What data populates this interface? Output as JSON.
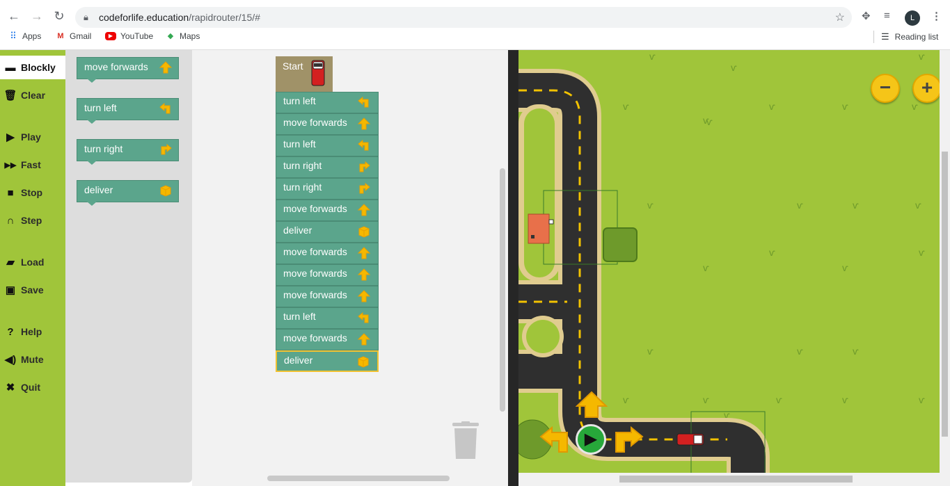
{
  "browser": {
    "url_host": "codeforlife.education",
    "url_path": "/rapidrouter/15/#",
    "avatar_letter": "L",
    "bookmarks": [
      {
        "label": "Apps",
        "icon": "apps-grid-icon"
      },
      {
        "label": "Gmail",
        "icon": "gmail-icon"
      },
      {
        "label": "YouTube",
        "icon": "youtube-icon"
      },
      {
        "label": "Maps",
        "icon": "maps-icon"
      }
    ],
    "reading_list": "Reading list"
  },
  "menu": {
    "items": [
      {
        "label": "Blockly",
        "icon": "blockly-icon"
      },
      {
        "label": "Clear",
        "icon": "trash-icon"
      },
      {
        "label": "Play",
        "icon": "play-icon"
      },
      {
        "label": "Fast",
        "icon": "fast-forward-icon"
      },
      {
        "label": "Stop",
        "icon": "stop-icon"
      },
      {
        "label": "Step",
        "icon": "step-icon"
      },
      {
        "label": "Load",
        "icon": "folder-icon"
      },
      {
        "label": "Save",
        "icon": "save-icon"
      },
      {
        "label": "Help",
        "icon": "help-icon"
      },
      {
        "label": "Mute",
        "icon": "speaker-icon"
      },
      {
        "label": "Quit",
        "icon": "close-icon"
      }
    ]
  },
  "toolbox": {
    "blocks": [
      {
        "label": "move forwards",
        "icon": "arrow-up-icon"
      },
      {
        "label": "turn left",
        "icon": "arrow-left-icon"
      },
      {
        "label": "turn right",
        "icon": "arrow-right-icon"
      },
      {
        "label": "deliver",
        "icon": "box-icon"
      }
    ]
  },
  "workspace": {
    "start_label": "Start",
    "program": [
      {
        "label": "turn left",
        "icon": "arrow-left-icon"
      },
      {
        "label": "move forwards",
        "icon": "arrow-up-icon"
      },
      {
        "label": "turn left",
        "icon": "arrow-left-icon"
      },
      {
        "label": "turn right",
        "icon": "arrow-right-icon"
      },
      {
        "label": "turn right",
        "icon": "arrow-right-icon"
      },
      {
        "label": "move forwards",
        "icon": "arrow-up-icon"
      },
      {
        "label": "deliver",
        "icon": "box-icon"
      },
      {
        "label": "move forwards",
        "icon": "arrow-up-icon"
      },
      {
        "label": "move forwards",
        "icon": "arrow-up-icon"
      },
      {
        "label": "move forwards",
        "icon": "arrow-up-icon"
      },
      {
        "label": "turn left",
        "icon": "arrow-left-icon"
      },
      {
        "label": "move forwards",
        "icon": "arrow-up-icon"
      },
      {
        "label": "deliver",
        "icon": "box-icon"
      }
    ]
  },
  "map": {
    "zoom_out": "−",
    "zoom_in": "+"
  },
  "colors": {
    "menu_green": "#a0c53a",
    "block_green": "#5ba58c",
    "start_brown": "#a09268",
    "arrow_yellow": "#f5b800",
    "road": "#2f2f2f"
  }
}
